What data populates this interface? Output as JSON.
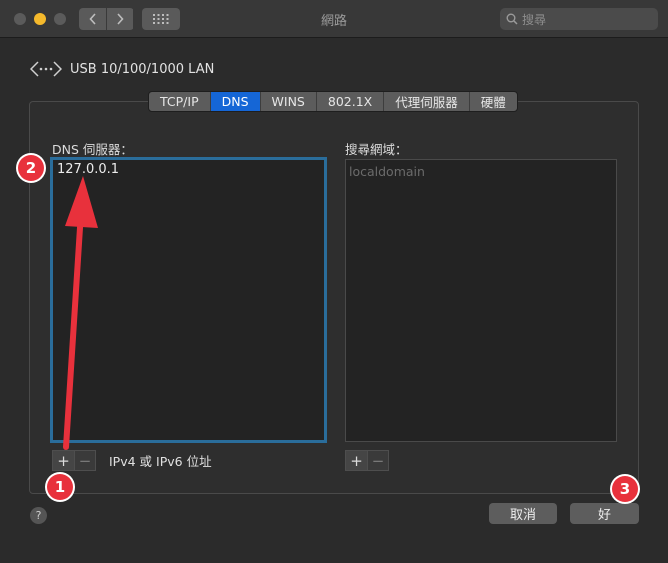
{
  "window": {
    "title": "網路",
    "search_placeholder": "搜尋",
    "nav_back_icon": "chevron-left-icon",
    "nav_forward_icon": "chevron-right-icon"
  },
  "interface": {
    "name": "USB 10/100/1000 LAN",
    "icon": "network-arrows-icon"
  },
  "tabs": [
    {
      "label": "TCP/IP",
      "active": false
    },
    {
      "label": "DNS",
      "active": true
    },
    {
      "label": "WINS",
      "active": false
    },
    {
      "label": "802.1X",
      "active": false
    },
    {
      "label": "代理伺服器",
      "active": false
    },
    {
      "label": "硬體",
      "active": false
    }
  ],
  "dns_servers": {
    "label": "DNS 伺服器：",
    "entries": [
      "127.0.0.1"
    ],
    "caption": "IPv4 或 IPv6 位址"
  },
  "search_domains": {
    "label": "搜尋網域：",
    "placeholder": "localdomain"
  },
  "buttons": {
    "add": "+",
    "remove": "−",
    "cancel": "取消",
    "ok": "好",
    "help": "?"
  },
  "annotations": {
    "badge_1": "1",
    "badge_2": "2",
    "badge_3": "3",
    "color": "#e8313c"
  }
}
